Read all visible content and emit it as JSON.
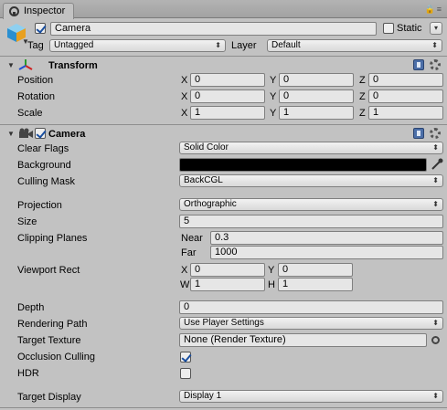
{
  "tab": {
    "title": "Inspector"
  },
  "header": {
    "object_name": "Camera",
    "static_label": "Static",
    "tag_label": "Tag",
    "tag_value": "Untagged",
    "layer_label": "Layer",
    "layer_value": "Default"
  },
  "transform": {
    "title": "Transform",
    "rows": [
      {
        "label": "Position",
        "x": "0",
        "y": "0",
        "z": "0"
      },
      {
        "label": "Rotation",
        "x": "0",
        "y": "0",
        "z": "0"
      },
      {
        "label": "Scale",
        "x": "1",
        "y": "1",
        "z": "1"
      }
    ],
    "axis": {
      "x": "X",
      "y": "Y",
      "z": "Z"
    }
  },
  "camera": {
    "title": "Camera",
    "clear_flags_label": "Clear Flags",
    "clear_flags_value": "Solid Color",
    "background_label": "Background",
    "background_color": "#000000",
    "culling_mask_label": "Culling Mask",
    "culling_mask_value": "BackCGL",
    "projection_label": "Projection",
    "projection_value": "Orthographic",
    "size_label": "Size",
    "size_value": "5",
    "clipping_label": "Clipping Planes",
    "near_label": "Near",
    "near_value": "0.3",
    "far_label": "Far",
    "far_value": "1000",
    "viewport_label": "Viewport Rect",
    "vp_x_label": "X",
    "vp_x": "0",
    "vp_y_label": "Y",
    "vp_y": "0",
    "vp_w_label": "W",
    "vp_w": "1",
    "vp_h_label": "H",
    "vp_h": "1",
    "depth_label": "Depth",
    "depth_value": "0",
    "rendering_path_label": "Rendering Path",
    "rendering_path_value": "Use Player Settings",
    "target_texture_label": "Target Texture",
    "target_texture_value": "None (Render Texture)",
    "occlusion_label": "Occlusion Culling",
    "occlusion_checked": true,
    "hdr_label": "HDR",
    "hdr_checked": false,
    "target_display_label": "Target Display",
    "target_display_value": "Display 1"
  },
  "colors": {
    "panel": "#c2c2c2",
    "field": "#e6e6e6",
    "accent": "#1a4fa0"
  }
}
